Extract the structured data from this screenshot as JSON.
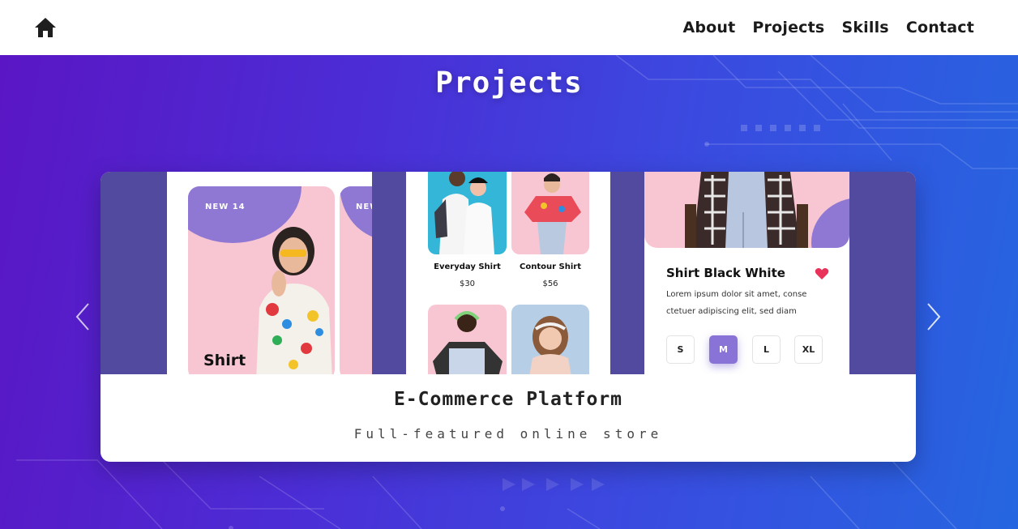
{
  "nav": {
    "home_icon": "home-icon",
    "links": [
      "About",
      "Projects",
      "Skills",
      "Contact"
    ]
  },
  "section": {
    "title": "Projects"
  },
  "project": {
    "title": "E-Commerce Platform",
    "subtitle": "Full-featured online store"
  },
  "mockup": {
    "badge_1": "NEW 14",
    "badge_2": "NEW",
    "category": "Shirt",
    "product_1_name": "Everyday Shirt",
    "product_1_price": "$30",
    "product_2_name": "Contour Shirt",
    "product_2_price": "$56",
    "detail_title": "Shirt Black White",
    "detail_desc_1": "Lorem ipsum dolor sit amet, conse",
    "detail_desc_2": "ctetuer adipiscing elit, sed diam",
    "sizes": [
      "S",
      "M",
      "L",
      "XL"
    ],
    "selected_size": "M"
  },
  "colors": {
    "accent": "#8a73d6",
    "heart": "#e8325a",
    "pink": "#f8c6d2",
    "card_bg": "#524a9e"
  },
  "controls": {
    "prev_icon": "chevron-left-icon",
    "next_icon": "chevron-right-icon"
  }
}
